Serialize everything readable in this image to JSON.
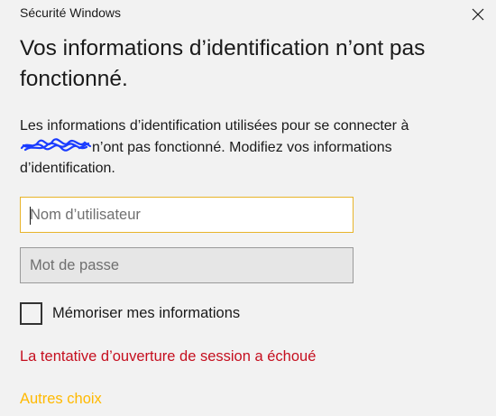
{
  "window": {
    "app_title": "Sécurité Windows"
  },
  "dialog": {
    "heading": "Vos informations d’identification n’ont pas fonctionné.",
    "message_line1": "Les informations d’identification utilisées pour se connecter à",
    "message_line2_rest": "n’ont pas fonctionné. Modifiez vos informations",
    "message_line3": "d’identification.",
    "username": {
      "value": "",
      "placeholder": "Nom d’utilisateur"
    },
    "password": {
      "value": "",
      "placeholder": "Mot de passe"
    },
    "remember_label": "Mémoriser mes informations",
    "remember_checked": false,
    "error_text": "La tentative d’ouverture de session a échoué",
    "more_choices": "Autres choix"
  },
  "colors": {
    "background": "#f2f2f2",
    "error": "#c50f1f",
    "link": "#ffb900",
    "focus_border": "#e8b42a",
    "redaction_scribble": "#1a3cff"
  },
  "icons": {
    "close": "close-icon"
  }
}
